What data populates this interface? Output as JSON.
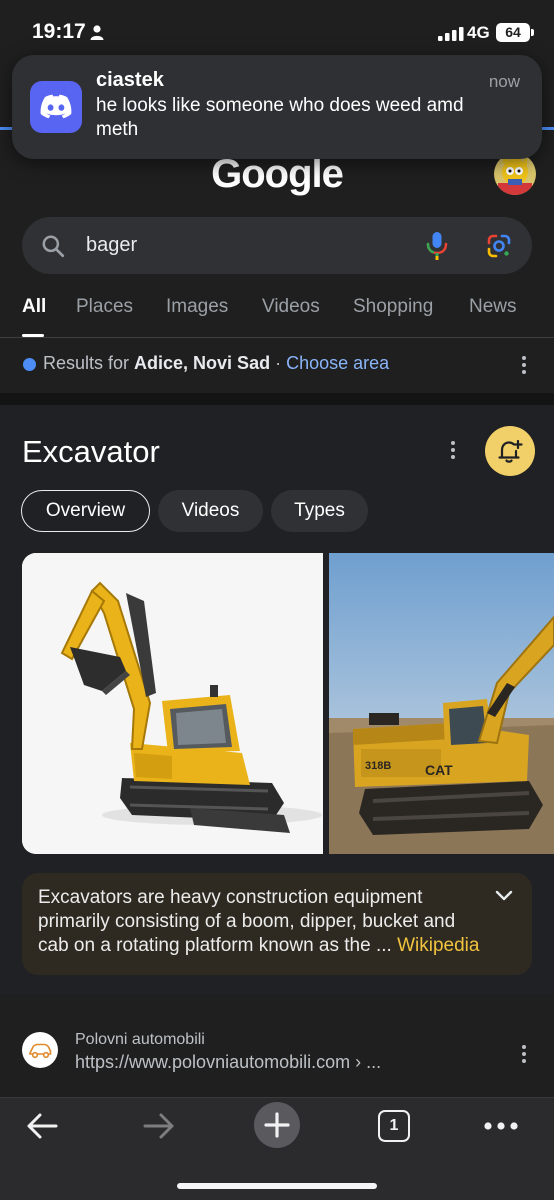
{
  "status_bar": {
    "time": "19:17",
    "network": "4G",
    "battery": "64"
  },
  "notification": {
    "app_name": "ciastek",
    "time": "now",
    "message": "he looks like someone who does weed amd meth",
    "icon": "discord-icon"
  },
  "google": {
    "logo_text": "Google"
  },
  "search": {
    "query": "bager"
  },
  "tabs": [
    {
      "label": "All",
      "active": true
    },
    {
      "label": "Places"
    },
    {
      "label": "Images"
    },
    {
      "label": "Videos"
    },
    {
      "label": "Shopping"
    },
    {
      "label": "News"
    }
  ],
  "location": {
    "prefix": "Results for ",
    "place": "Adice, Novi Sad",
    "separator": " · ",
    "link": "Choose area"
  },
  "knowledge_panel": {
    "title": "Excavator",
    "chips": [
      "Overview",
      "Videos",
      "Types"
    ],
    "right_image_texts": [
      "318B",
      "CAT"
    ],
    "description": "Excavators are heavy construction equipment primarily consisting of a boom, dipper, bucket and cab on a rotating platform known as the ... ",
    "source_link": "Wikipedia",
    "accent_color": "#f1d069"
  },
  "result": {
    "site_name": "Polovni automobili",
    "url": "https://www.polovniautomobili.com › ..."
  },
  "bottom_nav": {
    "tab_count": "1"
  }
}
